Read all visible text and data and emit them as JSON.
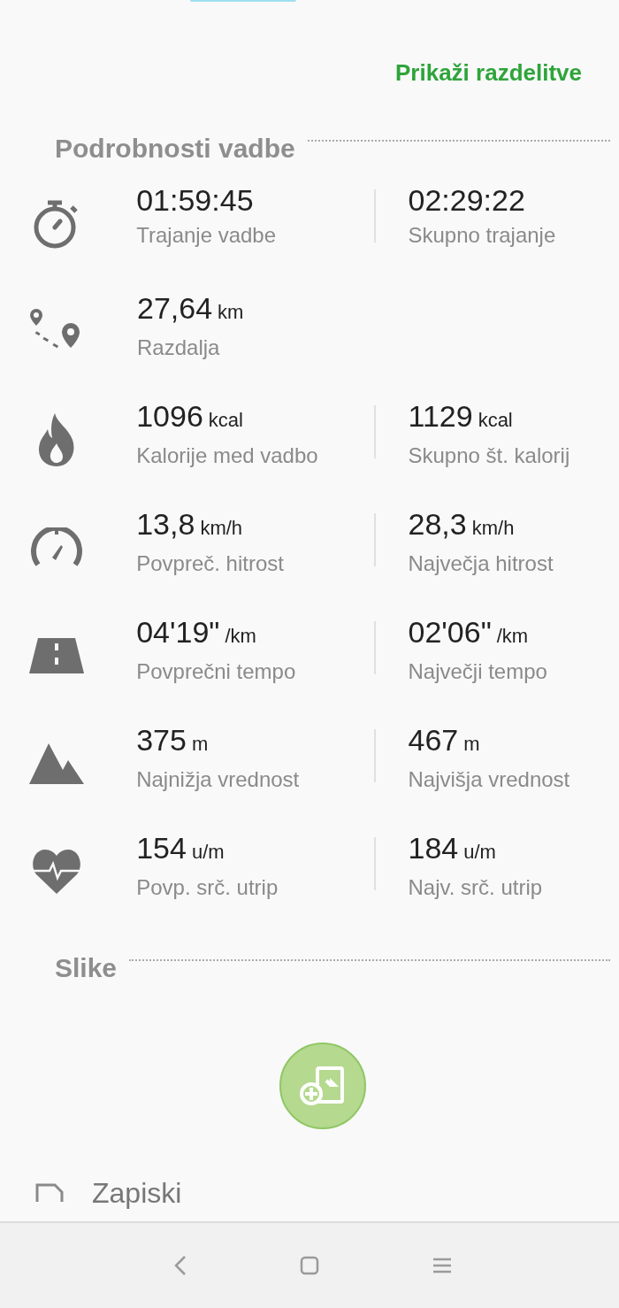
{
  "split_link": "Prikaži razdelitve",
  "details": {
    "heading": "Podrobnosti vadbe",
    "rows": [
      {
        "kind": "stopwatch",
        "left": {
          "value": "01:59:45",
          "label": "Trajanje vadbe"
        },
        "right": {
          "value": "02:29:22",
          "label": "Skupno trajanje"
        }
      },
      {
        "kind": "route",
        "left": {
          "value": "27,64",
          "unit": "km",
          "label": "Razdalja"
        }
      },
      {
        "kind": "flame",
        "left": {
          "value": "1096",
          "unit": "kcal",
          "label": "Kalorije med vadbo"
        },
        "right": {
          "value": "1129",
          "unit": "kcal",
          "label": "Skupno št. kalorij"
        }
      },
      {
        "kind": "speedometer",
        "left": {
          "value": "13,8",
          "unit": "km/h",
          "label": "Povpreč. hitrost"
        },
        "right": {
          "value": "28,3",
          "unit": "km/h",
          "label": "Največja hitrost"
        }
      },
      {
        "kind": "road",
        "left": {
          "value": "04'19\"",
          "unit": "/km",
          "label": "Povprečni tempo"
        },
        "right": {
          "value": "02'06\"",
          "unit": "/km",
          "label": "Največji tempo"
        }
      },
      {
        "kind": "mountain",
        "left": {
          "value": "375",
          "unit": "m",
          "label": "Najnižja vrednost"
        },
        "right": {
          "value": "467",
          "unit": "m",
          "label": "Najvišja vrednost"
        }
      },
      {
        "kind": "heart",
        "left": {
          "value": "154",
          "unit": "u/m",
          "label": "Povp. srč. utrip"
        },
        "right": {
          "value": "184",
          "unit": "u/m",
          "label": "Najv. srč. utrip"
        }
      }
    ]
  },
  "images": {
    "heading": "Slike"
  },
  "notes": {
    "heading": "Zapiski"
  }
}
